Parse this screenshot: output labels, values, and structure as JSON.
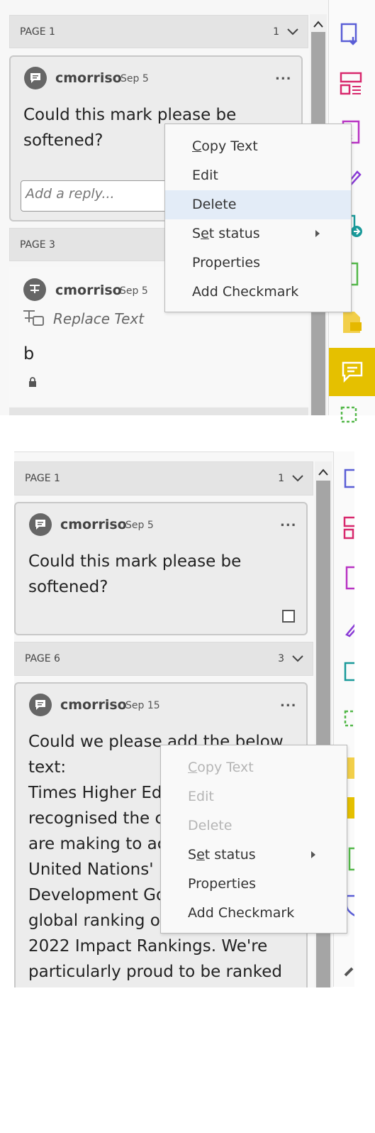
{
  "top": {
    "page1": {
      "label": "PAGE 1",
      "count": "1"
    },
    "comment1": {
      "author": "cmorriso",
      "date": "Sep 5",
      "more": "...",
      "text": "Could this mark please be softened?",
      "reply_placeholder": "Add a reply..."
    },
    "page3": {
      "label": "PAGE 3"
    },
    "comment2": {
      "author": "cmorriso",
      "date": "Sep 5",
      "type": "Replace Text",
      "text": "b"
    },
    "menu": {
      "items": [
        {
          "pre": "",
          "u": "C",
          "post": "opy Text"
        },
        {
          "pre": "Edit",
          "u": "",
          "post": ""
        },
        {
          "pre": "Delete",
          "u": "",
          "post": ""
        },
        {
          "pre": "S",
          "u": "e",
          "post": "t status"
        },
        {
          "pre": "Properties",
          "u": "",
          "post": ""
        },
        {
          "pre": "Add Checkmark",
          "u": "",
          "post": ""
        }
      ]
    }
  },
  "bottom": {
    "page1": {
      "label": "PAGE 1",
      "count": "1"
    },
    "comment1": {
      "author": "cmorriso",
      "date": "Sep 5",
      "more": "...",
      "text": "Could this mark please be softened?"
    },
    "page6": {
      "label": "PAGE 6",
      "count": "3"
    },
    "comment2": {
      "author": "cmorriso",
      "date": "Sep 15",
      "more": "...",
      "lines": [
        "Could we please add the below",
        "text:",
        "Times Higher Ed",
        "recognised the c",
        "are making to ac",
        "United Nations'",
        "Development Go",
        "global ranking o",
        "2022 Impact Rankings. We're",
        "particularly proud to be ranked"
      ]
    },
    "menu": {
      "items": [
        {
          "pre": "",
          "u": "C",
          "post": "opy Text"
        },
        {
          "pre": "Edit",
          "u": "",
          "post": ""
        },
        {
          "pre": "Delete",
          "u": "",
          "post": ""
        },
        {
          "pre": "S",
          "u": "e",
          "post": "t status"
        },
        {
          "pre": "Properties",
          "u": "",
          "post": ""
        },
        {
          "pre": "Add Checkmark",
          "u": "",
          "post": ""
        }
      ]
    }
  },
  "colors": {
    "accent_yellow": "#e5c000",
    "pdf_blue": "#5a5ed6",
    "pink": "#d8286d",
    "purple": "#9b35c9",
    "teal": "#1a9a9a",
    "green": "#54b84a",
    "highlight": "#e3ecf7"
  }
}
